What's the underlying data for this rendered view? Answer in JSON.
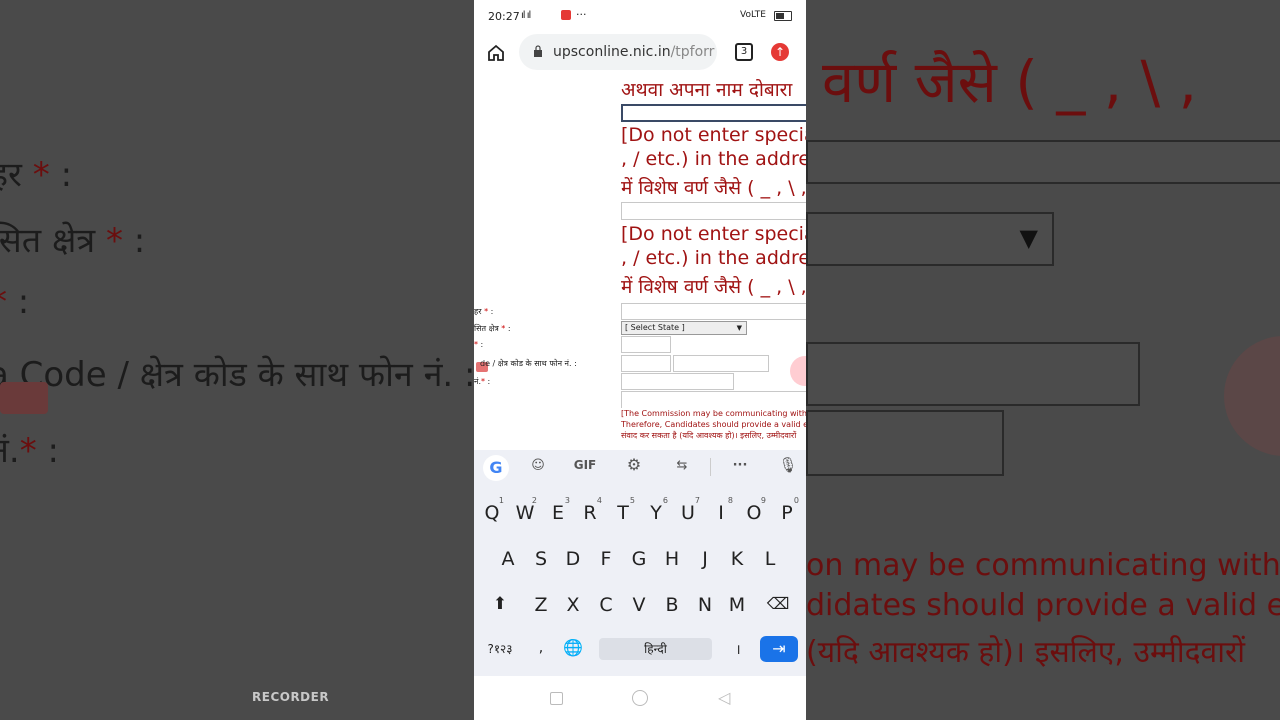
{
  "status_bar": {
    "time": "20:27",
    "signal": "⁴ᴳ.ıl.ıl",
    "more": "···",
    "right_icons": "VoLTE"
  },
  "browser": {
    "url_host": "upsconline.nic.in",
    "url_path": "/tpforr",
    "tab_count": "3"
  },
  "form": {
    "name_again_text": "अथवा अपना नाम दोबारा",
    "warning1_en_a": "[Do not enter specia",
    "warning1_en_b": ", / etc.) in the addres",
    "warning1_hi": "में विशेष वर्ण जैसे ( _ , \\ ,",
    "warning2_en_a": "[Do not enter specia",
    "warning2_en_b": ", / etc.) in the addres",
    "warning2_hi": "में विशेष वर्ण जैसे ( _ , \\ ,",
    "label_city": "हर",
    "label_state": "सित क्षेत्र",
    "label_pin": "",
    "label_phone": "de / क्षेत्र कोड के साथ फोन नं. :",
    "label_mobile": "नं.",
    "state_select": "[ Select State ]",
    "notice_line1": "[The Commission may be communicating with t",
    "notice_line2": "Therefore, Candidates should provide a valid e-m",
    "notice_line3": "संवाद कर सकता है (यदि आवश्यक हो)। इसलिए, उम्मीदवारों"
  },
  "keyboard": {
    "toolbar": {
      "gif": "GIF"
    },
    "row1": [
      "Q",
      "W",
      "E",
      "R",
      "T",
      "Y",
      "U",
      "I",
      "O",
      "P"
    ],
    "row1_nums": [
      "",
      "1",
      "2",
      "3",
      "4",
      "5",
      "6",
      "7",
      "8",
      "9",
      "0"
    ],
    "row2": [
      "A",
      "S",
      "D",
      "F",
      "G",
      "H",
      "J",
      "K",
      "L"
    ],
    "row3": [
      "Z",
      "X",
      "C",
      "V",
      "B",
      "N",
      "M"
    ],
    "sym_key": "?१२३",
    "comma": ",",
    "space_label": "हिन्दी",
    "danda": "।"
  },
  "watermark": "RECORDER",
  "background": {
    "left_city": "हर",
    "left_state": "सित क्षेत्र",
    "left_phone": "a Code / क्षेत्र कोड के साथ फोन नं. :",
    "left_mobile": "नं.",
    "right_chars": "वर्ण जैसे ( _ , \\ ,",
    "right_notice1": "on may be communicating with th",
    "right_notice2": "didates should provide a valid e-m",
    "right_notice3": "(यदि आवश्यक हो)। इसलिए, उम्मीदवारों"
  }
}
